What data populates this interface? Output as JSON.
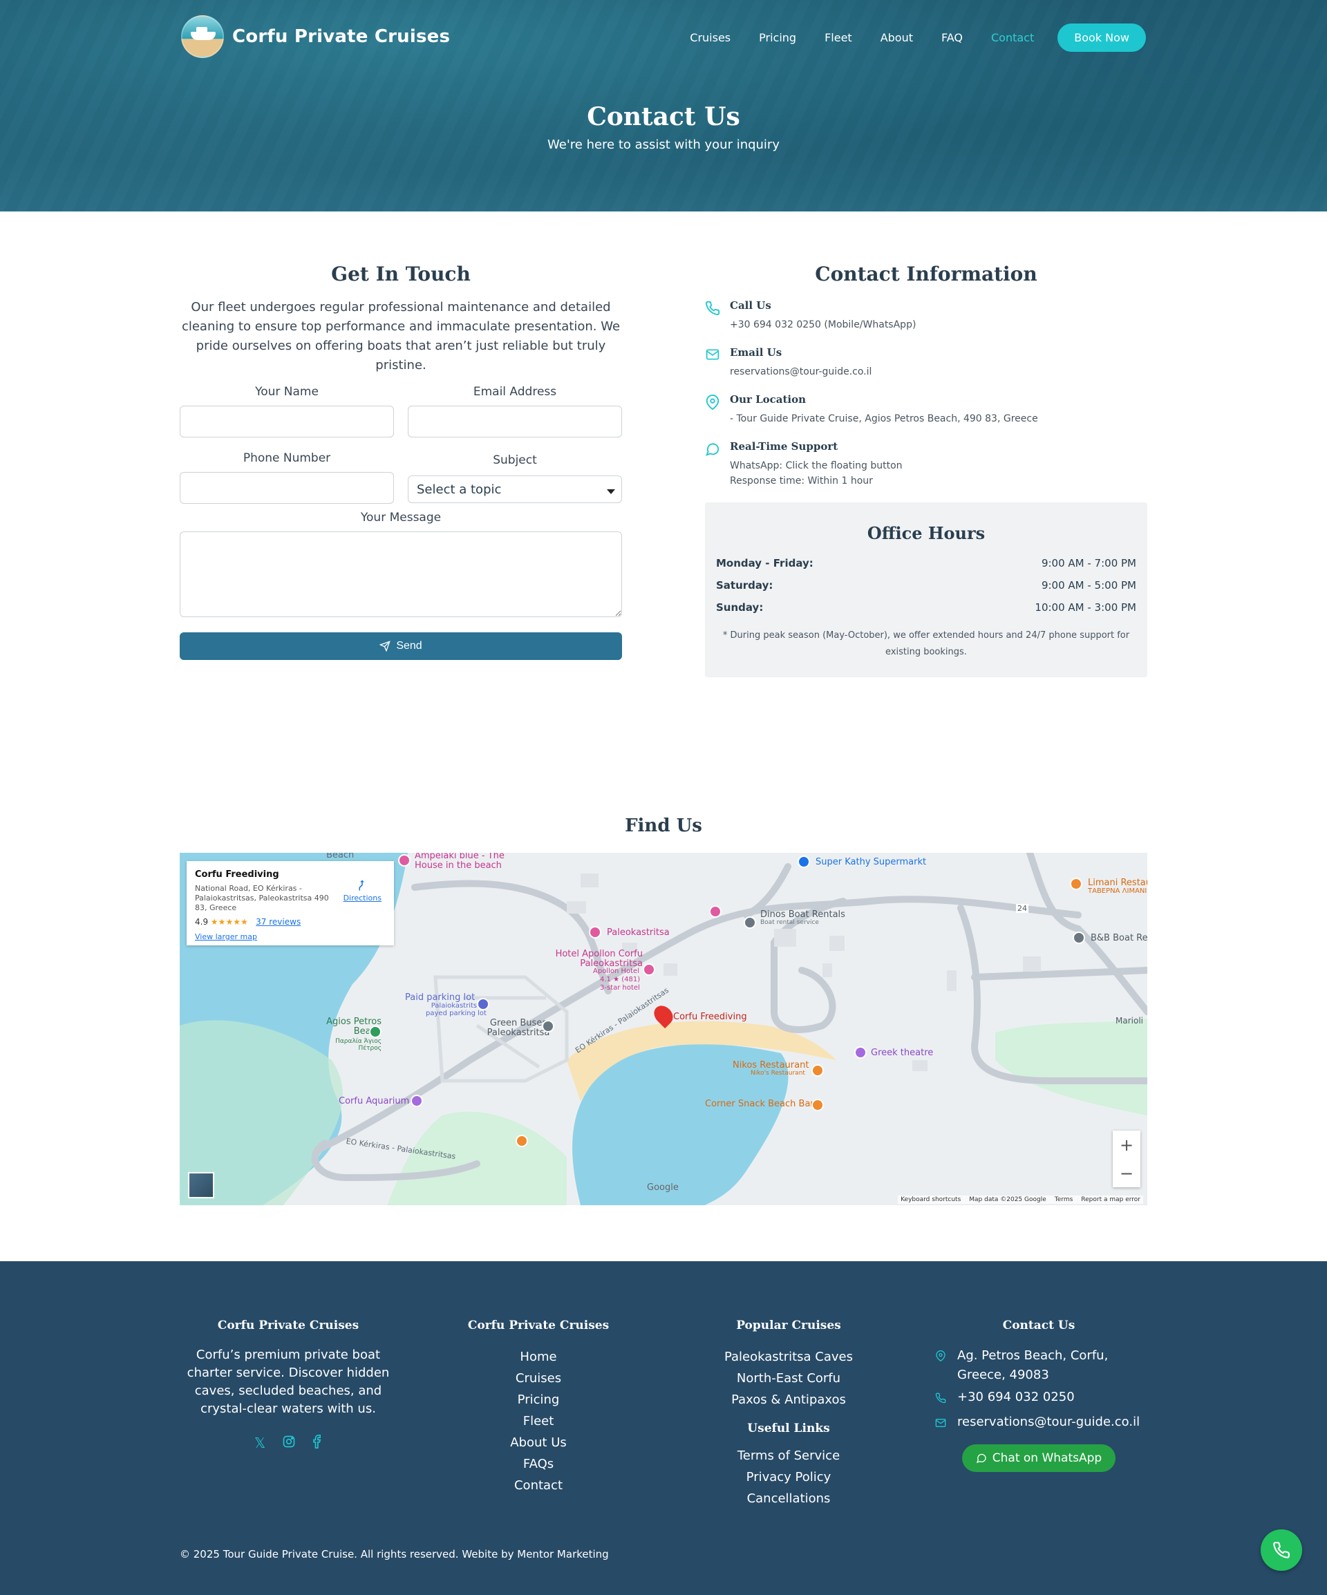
{
  "brand": {
    "name": "Corfu Private Cruises"
  },
  "nav": {
    "items": [
      "Cruises",
      "Pricing",
      "Fleet",
      "About",
      "FAQ",
      "Contact"
    ],
    "active": "Contact",
    "cta": "Book Now"
  },
  "hero": {
    "title": "Contact Us",
    "subtitle": "We're here to assist with your inquiry"
  },
  "form": {
    "title": "Get In Touch",
    "intro": "Our fleet undergoes regular professional maintenance and detailed cleaning to ensure top performance and immaculate presentation. We pride ourselves on offering boats that aren’t just reliable but truly pristine.",
    "name_label": "Your Name",
    "email_label": "Email Address",
    "phone_label": "Phone Number",
    "subject_label": "Subject",
    "subject_value": "Select a topic",
    "message_label": "Your Message",
    "send_label": "Send"
  },
  "contact": {
    "title": "Contact Information",
    "items": [
      {
        "icon": "phone-icon",
        "title": "Call Us",
        "lines": [
          "+30 694 032 0250 (Mobile/WhatsApp)"
        ]
      },
      {
        "icon": "mail-icon",
        "title": "Email Us",
        "lines": [
          "reservations@tour-guide.co.il"
        ]
      },
      {
        "icon": "location-icon",
        "title": "Our Location",
        "lines": [
          "- Tour Guide Private Cruise, Agios Petros Beach, 490 83, Greece"
        ]
      },
      {
        "icon": "chat-icon",
        "title": "Real-Time Support",
        "lines": [
          "WhatsApp: Click the floating button",
          "Response time: Within 1 hour"
        ]
      }
    ]
  },
  "hours": {
    "title": "Office Hours",
    "rows": [
      {
        "day": "Monday - Friday:",
        "time": "9:00 AM - 7:00 PM"
      },
      {
        "day": "Saturday:",
        "time": "9:00 AM - 5:00 PM"
      },
      {
        "day": "Sunday:",
        "time": "10:00 AM - 3:00 PM"
      }
    ],
    "note": "* During peak season (May-October), we offer extended hours and 24/7 phone support for existing bookings."
  },
  "map": {
    "title": "Find Us",
    "card": {
      "name": "Corfu Freediving",
      "address": "National Road, EO Kérkiras - Palaiokastritsas, Paleokastritsa 490 83, Greece",
      "rating": "4.9",
      "stars": "★★★★★",
      "reviews": "37 reviews",
      "larger": "View larger map",
      "directions": "Directions"
    },
    "labels": {
      "beach": "Beach",
      "ampelaki": "Ampelaki blue - The House in the beach",
      "kathy": "Super Kathy Supermarkt",
      "limani": "Limani Restau",
      "limani2": "ΤΑΒΕΡΝΑ ΛΙΜΑΝΙ",
      "dinos": "Dinos Boat Rentals",
      "dinos2": "Boat rental service",
      "bb": "B&B Boat Rer",
      "paleo": "Paleokastritsa",
      "apollon": "Hotel Apollon Corfu Paleokastritsa",
      "apollon2": "Apollon Hotel",
      "apollon3": "4.1 ★ (481)",
      "apollon4": "3-star hotel",
      "parking": "Paid parking lot",
      "parking2": "Palaiokastritsa payed parking lot",
      "buses": "Green Buses Paleokastritsa",
      "agios": "Agios Petros Beach",
      "agios2": "Παραλία Άγιος Πέτρος",
      "freediving": "Corfu Freediving",
      "road1": "EO Kérkiras - Palaiokastritsas",
      "road2": "EO Kérkiras - Palaiokastritsas",
      "greek": "Greek theatre",
      "nikos": "Nikos Restaurant",
      "nikos2": "Niko's Restaurant",
      "corner": "Corner Snack Beach Bar",
      "aquarium": "Corfu Aquarium",
      "marioli": "Marioli",
      "route": "24"
    },
    "zoom_in": "+",
    "zoom_out": "−",
    "google": "Google",
    "footer": [
      "Keyboard shortcuts",
      "Map data ©2025 Google",
      "Terms",
      "Report a map error"
    ]
  },
  "footer": {
    "about": {
      "title": "Corfu Private Cruises",
      "text": "Corfu’s premium private boat charter service. Discover hidden caves, secluded beaches, and crystal-clear waters with us."
    },
    "links": {
      "title": "Corfu Private Cruises",
      "items": [
        "Home",
        "Cruises",
        "Pricing",
        "Fleet",
        "About Us",
        "FAQs",
        "Contact"
      ]
    },
    "popular": {
      "title": "Popular Cruises",
      "items": [
        "Paleokastritsa Caves",
        "North-East Corfu",
        "Paxos & Antipaxos"
      ]
    },
    "useful": {
      "title": "Useful Links",
      "items": [
        "Terms of Service",
        "Privacy Policy",
        "Cancellations"
      ]
    },
    "contact": {
      "title": "Contact Us",
      "address": "Ag. Petros Beach, Corfu, Greece, 49083",
      "phone": "+30 694 032 0250",
      "email": "reservations@tour-guide.co.il",
      "whatsapp": "Chat on WhatsApp"
    },
    "copyright": "© 2025 Tour Guide Private Cruise. All rights reserved. Webite by Mentor Marketing"
  },
  "colors": {
    "accent": "#1ec7cf",
    "primary": "#2b7294",
    "footer": "#274a66",
    "whatsapp": "#22c25e"
  }
}
